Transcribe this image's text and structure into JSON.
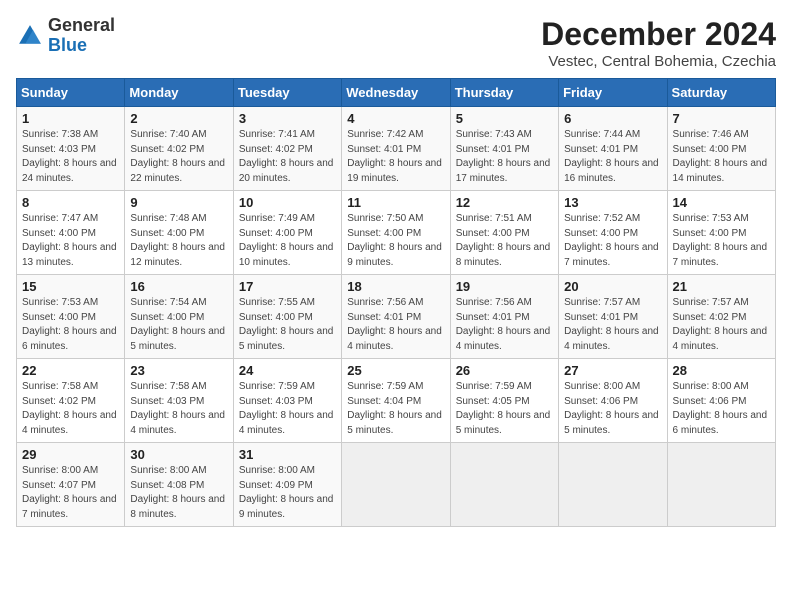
{
  "logo": {
    "general": "General",
    "blue": "Blue"
  },
  "header": {
    "month": "December 2024",
    "location": "Vestec, Central Bohemia, Czechia"
  },
  "weekdays": [
    "Sunday",
    "Monday",
    "Tuesday",
    "Wednesday",
    "Thursday",
    "Friday",
    "Saturday"
  ],
  "weeks": [
    [
      {
        "day": "1",
        "rise": "7:38 AM",
        "set": "4:03 PM",
        "daylight": "8 hours and 24 minutes."
      },
      {
        "day": "2",
        "rise": "7:40 AM",
        "set": "4:02 PM",
        "daylight": "8 hours and 22 minutes."
      },
      {
        "day": "3",
        "rise": "7:41 AM",
        "set": "4:02 PM",
        "daylight": "8 hours and 20 minutes."
      },
      {
        "day": "4",
        "rise": "7:42 AM",
        "set": "4:01 PM",
        "daylight": "8 hours and 19 minutes."
      },
      {
        "day": "5",
        "rise": "7:43 AM",
        "set": "4:01 PM",
        "daylight": "8 hours and 17 minutes."
      },
      {
        "day": "6",
        "rise": "7:44 AM",
        "set": "4:01 PM",
        "daylight": "8 hours and 16 minutes."
      },
      {
        "day": "7",
        "rise": "7:46 AM",
        "set": "4:00 PM",
        "daylight": "8 hours and 14 minutes."
      }
    ],
    [
      {
        "day": "8",
        "rise": "7:47 AM",
        "set": "4:00 PM",
        "daylight": "8 hours and 13 minutes."
      },
      {
        "day": "9",
        "rise": "7:48 AM",
        "set": "4:00 PM",
        "daylight": "8 hours and 12 minutes."
      },
      {
        "day": "10",
        "rise": "7:49 AM",
        "set": "4:00 PM",
        "daylight": "8 hours and 10 minutes."
      },
      {
        "day": "11",
        "rise": "7:50 AM",
        "set": "4:00 PM",
        "daylight": "8 hours and 9 minutes."
      },
      {
        "day": "12",
        "rise": "7:51 AM",
        "set": "4:00 PM",
        "daylight": "8 hours and 8 minutes."
      },
      {
        "day": "13",
        "rise": "7:52 AM",
        "set": "4:00 PM",
        "daylight": "8 hours and 7 minutes."
      },
      {
        "day": "14",
        "rise": "7:53 AM",
        "set": "4:00 PM",
        "daylight": "8 hours and 7 minutes."
      }
    ],
    [
      {
        "day": "15",
        "rise": "7:53 AM",
        "set": "4:00 PM",
        "daylight": "8 hours and 6 minutes."
      },
      {
        "day": "16",
        "rise": "7:54 AM",
        "set": "4:00 PM",
        "daylight": "8 hours and 5 minutes."
      },
      {
        "day": "17",
        "rise": "7:55 AM",
        "set": "4:00 PM",
        "daylight": "8 hours and 5 minutes."
      },
      {
        "day": "18",
        "rise": "7:56 AM",
        "set": "4:01 PM",
        "daylight": "8 hours and 4 minutes."
      },
      {
        "day": "19",
        "rise": "7:56 AM",
        "set": "4:01 PM",
        "daylight": "8 hours and 4 minutes."
      },
      {
        "day": "20",
        "rise": "7:57 AM",
        "set": "4:01 PM",
        "daylight": "8 hours and 4 minutes."
      },
      {
        "day": "21",
        "rise": "7:57 AM",
        "set": "4:02 PM",
        "daylight": "8 hours and 4 minutes."
      }
    ],
    [
      {
        "day": "22",
        "rise": "7:58 AM",
        "set": "4:02 PM",
        "daylight": "8 hours and 4 minutes."
      },
      {
        "day": "23",
        "rise": "7:58 AM",
        "set": "4:03 PM",
        "daylight": "8 hours and 4 minutes."
      },
      {
        "day": "24",
        "rise": "7:59 AM",
        "set": "4:03 PM",
        "daylight": "8 hours and 4 minutes."
      },
      {
        "day": "25",
        "rise": "7:59 AM",
        "set": "4:04 PM",
        "daylight": "8 hours and 5 minutes."
      },
      {
        "day": "26",
        "rise": "7:59 AM",
        "set": "4:05 PM",
        "daylight": "8 hours and 5 minutes."
      },
      {
        "day": "27",
        "rise": "8:00 AM",
        "set": "4:06 PM",
        "daylight": "8 hours and 5 minutes."
      },
      {
        "day": "28",
        "rise": "8:00 AM",
        "set": "4:06 PM",
        "daylight": "8 hours and 6 minutes."
      }
    ],
    [
      {
        "day": "29",
        "rise": "8:00 AM",
        "set": "4:07 PM",
        "daylight": "8 hours and 7 minutes."
      },
      {
        "day": "30",
        "rise": "8:00 AM",
        "set": "4:08 PM",
        "daylight": "8 hours and 8 minutes."
      },
      {
        "day": "31",
        "rise": "8:00 AM",
        "set": "4:09 PM",
        "daylight": "8 hours and 9 minutes."
      },
      null,
      null,
      null,
      null
    ]
  ],
  "labels": {
    "sunrise": "Sunrise:",
    "sunset": "Sunset:",
    "daylight": "Daylight:"
  }
}
